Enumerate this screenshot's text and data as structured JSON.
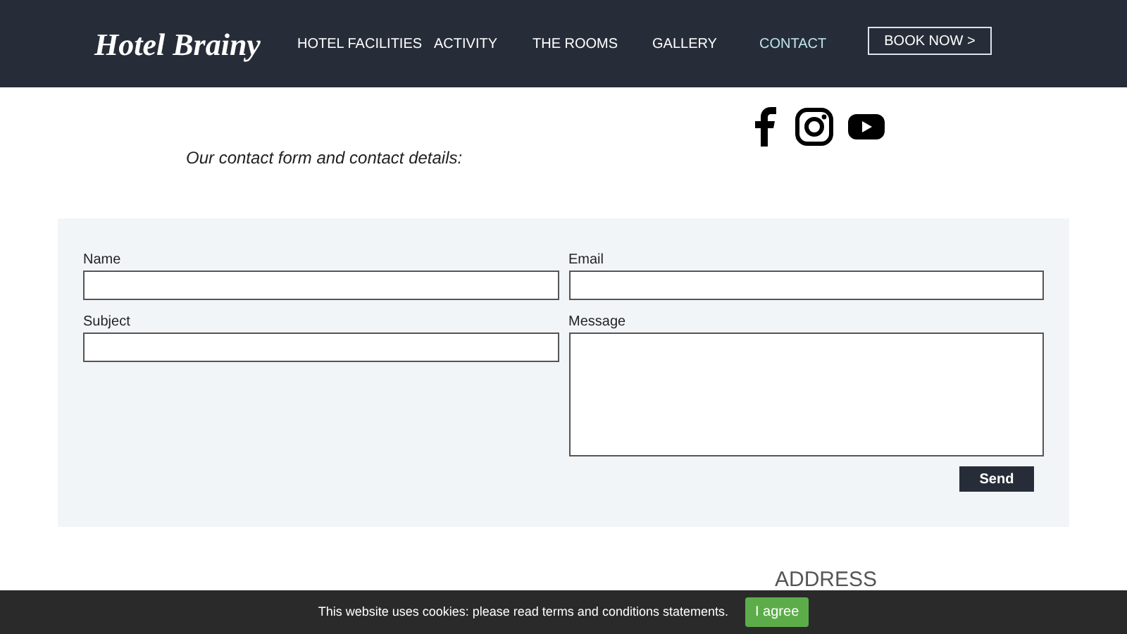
{
  "header": {
    "logo": "Hotel Brainy",
    "nav": [
      {
        "label": "HOTEL FACILITIES",
        "selected": false
      },
      {
        "label": "ACTIVITY",
        "selected": false
      },
      {
        "label": "THE ROOMS",
        "selected": false
      },
      {
        "label": "GALLERY",
        "selected": false
      },
      {
        "label": "CONTACT",
        "selected": true
      }
    ],
    "book_button": "BOOK NOW >"
  },
  "intro": "Our contact form and contact details:",
  "form": {
    "fields": [
      {
        "label": "Name",
        "kind": "input"
      },
      {
        "label": "Email",
        "kind": "input"
      },
      {
        "label": "Subject",
        "kind": "input"
      },
      {
        "label": "Message",
        "kind": "textarea"
      }
    ],
    "submit": "Send"
  },
  "address_heading": "ADDRESS",
  "cookie_bar": {
    "text": "This website uses cookies: please read terms and conditions statements.",
    "button": "I agree"
  }
}
